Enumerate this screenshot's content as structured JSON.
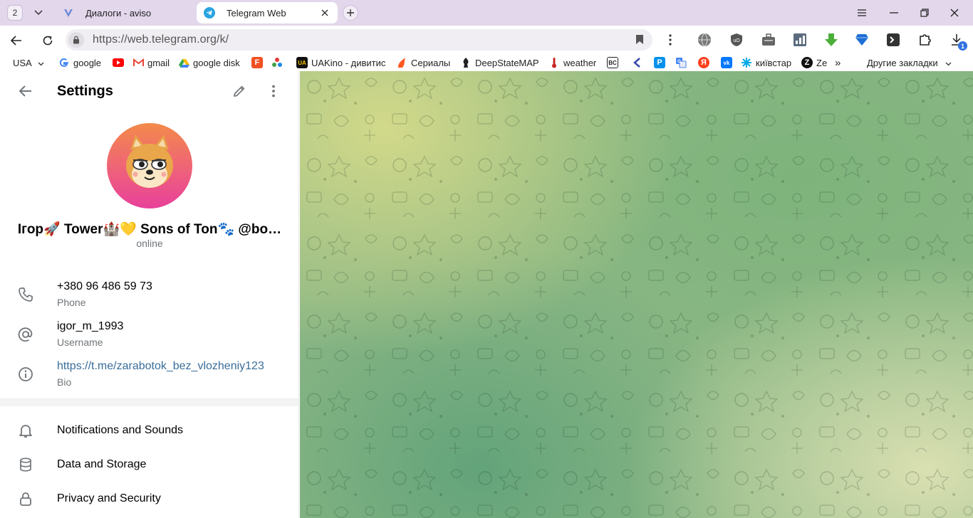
{
  "browser": {
    "tab_count": "2",
    "tabs": [
      {
        "title": "Диалоги - aviso",
        "active": false
      },
      {
        "title": "Telegram Web",
        "active": true
      }
    ],
    "url": "https://web.telegram.org/k/",
    "extension_badge": "1"
  },
  "bookmarks": {
    "items": [
      {
        "label": "USA",
        "icon": "dropdown-chevron"
      },
      {
        "label": "google",
        "icon": "google-icon"
      },
      {
        "label": "",
        "icon": "youtube-icon"
      },
      {
        "label": "gmail",
        "icon": "gmail-icon"
      },
      {
        "label": "google disk",
        "icon": "google-drive-icon"
      },
      {
        "label": "",
        "icon": "f-icon"
      },
      {
        "label": "",
        "icon": "star-cluster-icon"
      },
      {
        "label": "UAKino - дивитис",
        "icon": "uakino-icon"
      },
      {
        "label": "Сериалы",
        "icon": "fox-icon"
      },
      {
        "label": "DeepStateMAP",
        "icon": "deepstate-icon"
      },
      {
        "label": "weather",
        "icon": "thermometer-icon"
      },
      {
        "label": "",
        "icon": "bc-icon"
      },
      {
        "label": "",
        "icon": "arrow-icon"
      },
      {
        "label": "",
        "icon": "p-icon"
      },
      {
        "label": "",
        "icon": "translate-icon"
      },
      {
        "label": "",
        "icon": "yandex-icon"
      },
      {
        "label": "",
        "icon": "vk-icon"
      },
      {
        "label": "київстар",
        "icon": "kyivstar-icon"
      },
      {
        "label": "Ze",
        "icon": "z-icon"
      }
    ],
    "overflow": "»",
    "other_bookmarks": "Другие закладки"
  },
  "settings": {
    "title": "Settings",
    "profile": {
      "name": "Ігор🚀 Tower🏰💛 Sons of Ton🐾 @bo…",
      "status": "online"
    },
    "info": [
      {
        "value": "+380 96 486 59 73",
        "label": "Phone",
        "icon": "phone-icon"
      },
      {
        "value": "igor_m_1993",
        "label": "Username",
        "icon": "at-icon"
      },
      {
        "value": "https://t.me/zarabotok_bez_vlozheniy123",
        "label": "Bio",
        "icon": "info-icon"
      }
    ],
    "menu": [
      {
        "label": "Notifications and Sounds",
        "icon": "bell-icon"
      },
      {
        "label": "Data and Storage",
        "icon": "database-icon"
      },
      {
        "label": "Privacy and Security",
        "icon": "lock-icon"
      }
    ]
  },
  "colors": {
    "accent": "#3390ec",
    "link": "#3a6d99",
    "secondary_text": "#707579",
    "tabbar": "#e3d7ec",
    "avatar_top": "#f38a4a",
    "avatar_bottom": "#e8409a"
  }
}
